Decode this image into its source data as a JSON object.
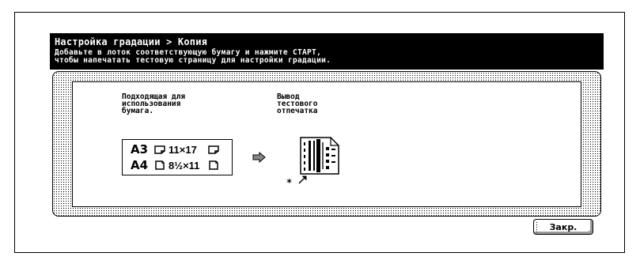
{
  "header": {
    "title": "Настройка градации > Копия",
    "instruction": "Добавьте в лоток соответствующую бумагу и нажмите СТАРТ,\nчтобы напечатать тестовую страницу для настройки градации."
  },
  "content": {
    "paper_label": "Подходящая для\nиспользования\nбумага.",
    "output_label": "Вывод\nтестового\nотпечатка",
    "paper_sizes": [
      {
        "size1": "A3",
        "size2": "11×17"
      },
      {
        "size1": "A4",
        "size2": "8½×11"
      }
    ],
    "asterisk": "*"
  },
  "footer": {
    "close_label": "Закр."
  },
  "icons": [
    "paper-orientation-icon",
    "right-arrow-icon",
    "test-print-icon"
  ]
}
